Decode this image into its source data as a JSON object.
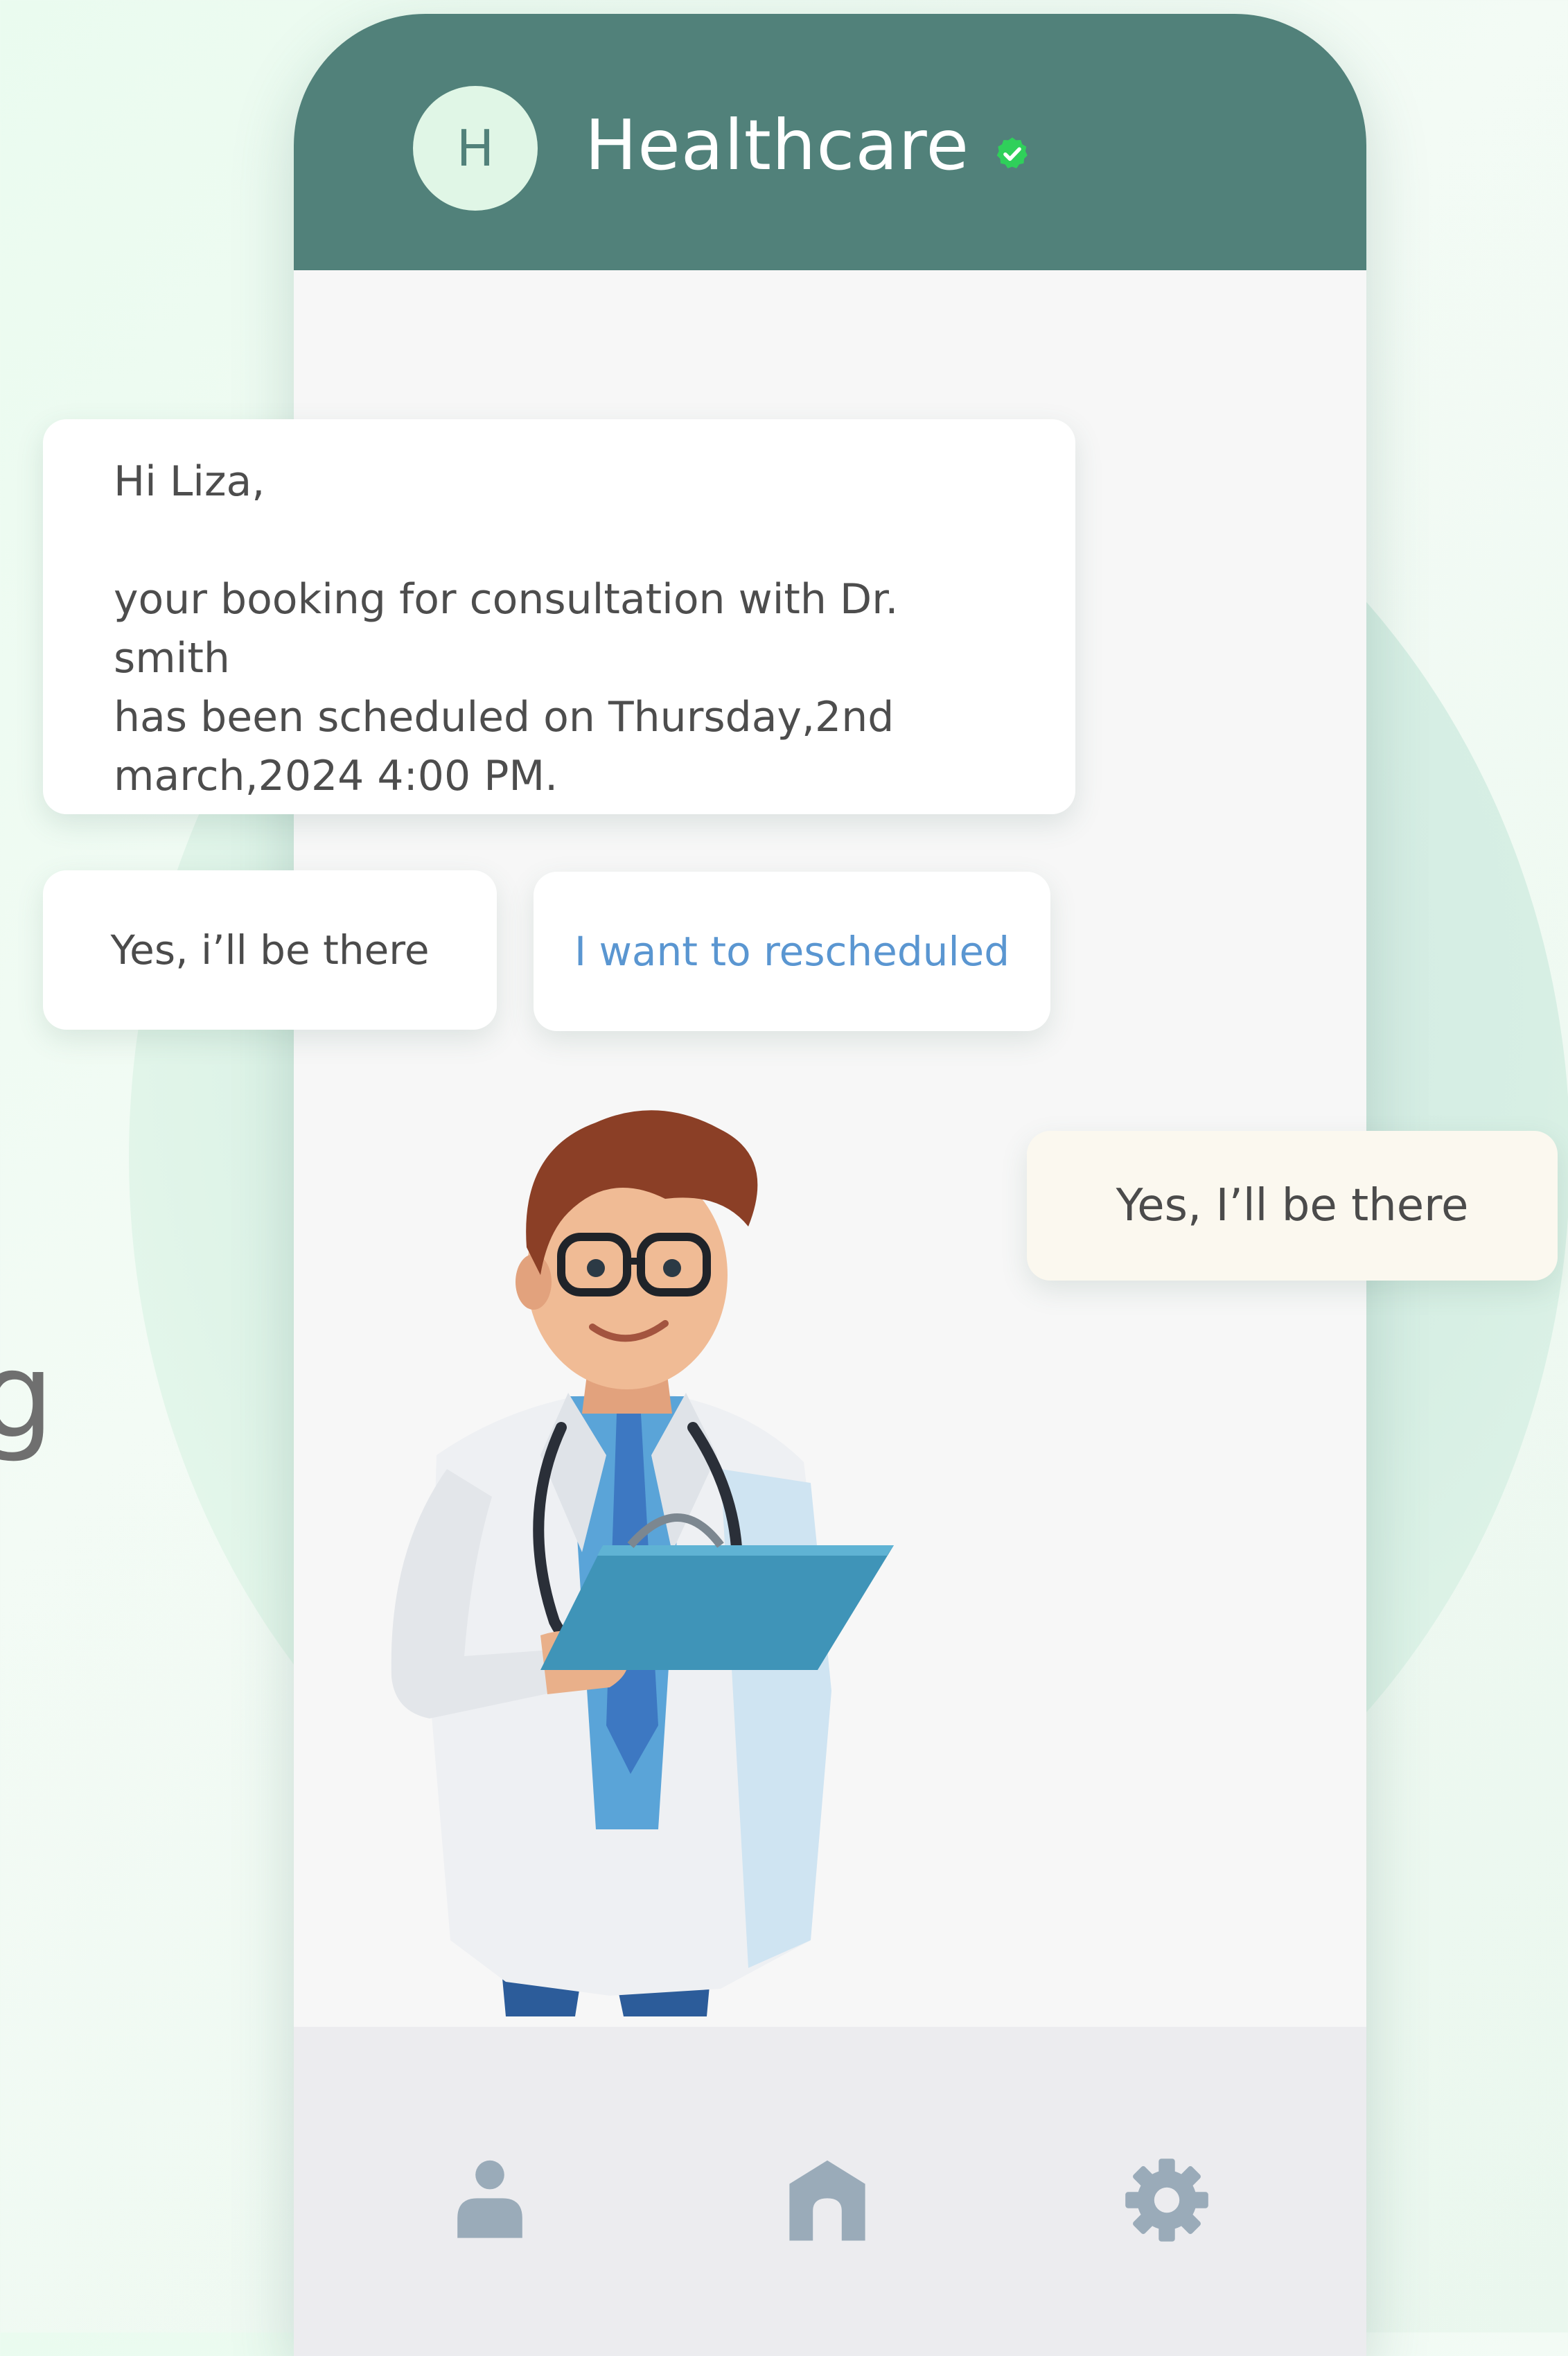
{
  "background": {
    "partial_glyph": "g"
  },
  "header": {
    "avatar_letter": "H",
    "title": "Healthcare",
    "verified_icon": "verified-check-icon",
    "colors": {
      "header_bg": "#51817a",
      "avatar_bg": "#e0f6e6",
      "verified": "#2fd05a"
    }
  },
  "chat": {
    "message": {
      "greeting": "Hi Liza,",
      "lines": [
        "your booking for consultation with Dr. smith",
        "has been scheduled on Thursday,2nd",
        "march,2024 4:00 PM."
      ]
    },
    "quick_replies": [
      {
        "label": "Yes, i’ll be there"
      },
      {
        "label": "I want to rescheduled",
        "color": "#5a96d1"
      }
    ],
    "sent_reply": "Yes, I’ll be there"
  },
  "illustration": {
    "name": "doctor-illustration"
  },
  "bottom_nav": {
    "items": [
      {
        "icon": "profile-icon"
      },
      {
        "icon": "home-icon"
      },
      {
        "icon": "settings-icon"
      }
    ],
    "icon_color": "#9aabb9"
  }
}
